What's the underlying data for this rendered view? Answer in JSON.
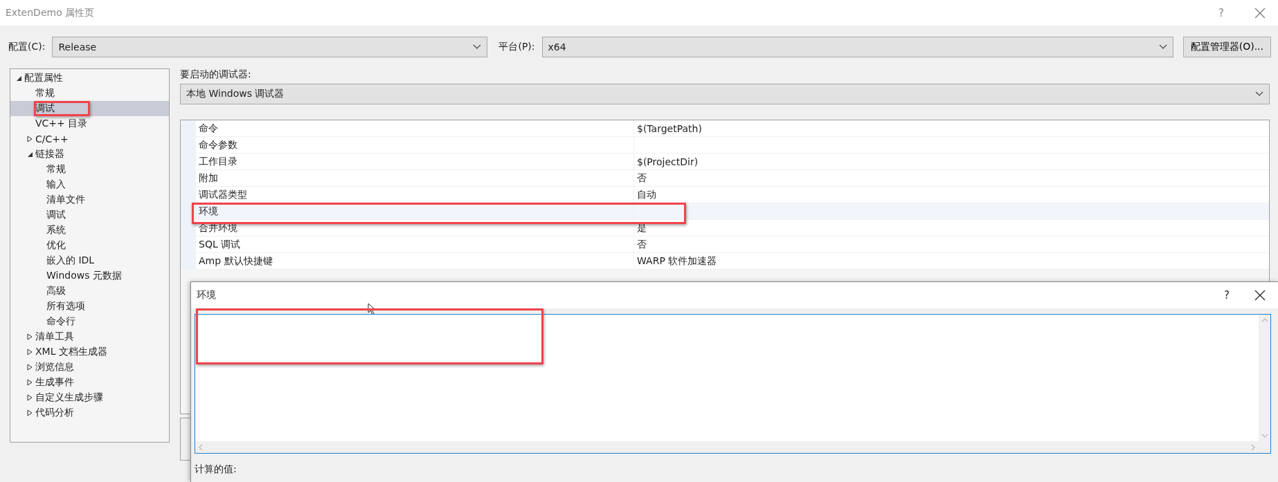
{
  "window": {
    "title": "ExtenDemo 属性页",
    "help": "?"
  },
  "config": {
    "config_label": "配置(C):",
    "config_value": "Release",
    "platform_label": "平台(P):",
    "platform_value": "x64",
    "manager_button": "配置管理器(O)..."
  },
  "tree": [
    {
      "label": "配置属性",
      "expanded": true,
      "selected": false,
      "highlighted": false,
      "children": [
        {
          "label": "常规",
          "selected": false,
          "highlighted": false
        },
        {
          "label": "调试",
          "selected": true,
          "highlighted": true
        },
        {
          "label": "VC++ 目录",
          "selected": false,
          "highlighted": false
        },
        {
          "label": "C/C++",
          "expanded": false,
          "selected": false,
          "highlighted": false
        },
        {
          "label": "链接器",
          "expanded": true,
          "selected": false,
          "highlighted": false,
          "children": [
            {
              "label": "常规",
              "selected": false,
              "highlighted": false
            },
            {
              "label": "输入",
              "selected": false,
              "highlighted": false
            },
            {
              "label": "清单文件",
              "selected": false,
              "highlighted": false
            },
            {
              "label": "调试",
              "selected": false,
              "highlighted": false
            },
            {
              "label": "系统",
              "selected": false,
              "highlighted": false
            },
            {
              "label": "优化",
              "selected": false,
              "highlighted": false
            },
            {
              "label": "嵌入的 IDL",
              "selected": false,
              "highlighted": false
            },
            {
              "label": "Windows 元数据",
              "selected": false,
              "highlighted": false
            },
            {
              "label": "高级",
              "selected": false,
              "highlighted": false
            },
            {
              "label": "所有选项",
              "selected": false,
              "highlighted": false
            },
            {
              "label": "命令行",
              "selected": false,
              "highlighted": false
            }
          ]
        },
        {
          "label": "清单工具",
          "expanded": false,
          "selected": false,
          "highlighted": false
        },
        {
          "label": "XML 文档生成器",
          "expanded": false,
          "selected": false,
          "highlighted": false
        },
        {
          "label": "浏览信息",
          "expanded": false,
          "selected": false,
          "highlighted": false
        },
        {
          "label": "生成事件",
          "expanded": false,
          "selected": false,
          "highlighted": false
        },
        {
          "label": "自定义生成步骤",
          "expanded": false,
          "selected": false,
          "highlighted": false
        },
        {
          "label": "代码分析",
          "expanded": false,
          "selected": false,
          "highlighted": false
        }
      ]
    }
  ],
  "debugger": {
    "label": "要启动的调试器:",
    "value": "本地 Windows 调试器"
  },
  "properties": [
    {
      "name": "命令",
      "value": "$(TargetPath)",
      "selected": false,
      "highlighted": false
    },
    {
      "name": "命令参数",
      "selected": false,
      "highlighted": false
    },
    {
      "name": "工作目录",
      "value": "$(ProjectDir)",
      "selected": false,
      "highlighted": false
    },
    {
      "name": "附加",
      "value": "否",
      "selected": false,
      "highlighted": false
    },
    {
      "name": "调试器类型",
      "value": "自动",
      "selected": false,
      "highlighted": false
    },
    {
      "name": "环境",
      "selected": true,
      "highlighted": true
    },
    {
      "name": "合并环境",
      "value": "是",
      "selected": false,
      "highlighted": false
    },
    {
      "name": "SQL 调试",
      "value": "否",
      "selected": false,
      "highlighted": false
    },
    {
      "name": "Amp 默认快捷键",
      "value": "WARP 软件加速器",
      "selected": false,
      "highlighted": false
    }
  ],
  "dialog": {
    "title": "环境",
    "help": "?",
    "input_highlighted": true,
    "computed_label": "计算的值:"
  }
}
